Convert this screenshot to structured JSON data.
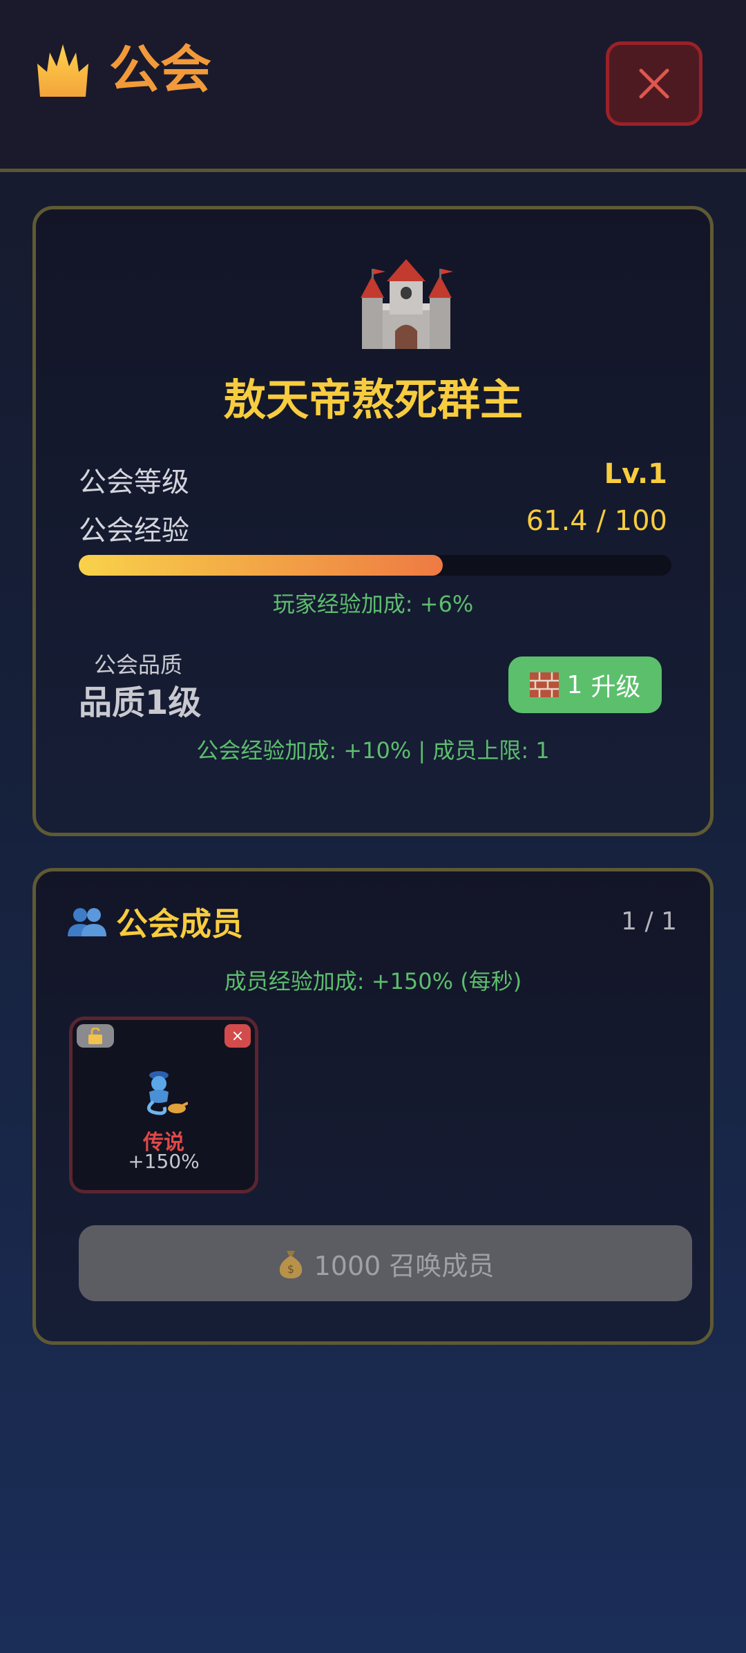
{
  "header": {
    "title": "公会",
    "crown_icon": "crown-icon",
    "close_icon": "close-icon"
  },
  "guild": {
    "castle_icon": "castle-icon",
    "name": "敖天帝熬死群主",
    "level_label": "公会等级",
    "level_value": "Lv.1",
    "exp_label": "公会经验",
    "exp_value": "61.4 / 100",
    "exp_progress": 0.614,
    "player_bonus": "玩家经验加成: +6%",
    "quality_label": "公会品质",
    "quality_value": "品质1级",
    "upgrade_cost": "1",
    "upgrade_label": "升级",
    "upgrade_icon": "brick-icon",
    "quality_bonus": "公会经验加成: +10% | 成员上限: 1"
  },
  "members": {
    "icon": "people-icon",
    "title": "公会成员",
    "count": "1 / 1",
    "bonus": "成员经验加成: +150% (每秒)",
    "list": [
      {
        "avatar": "genie-icon",
        "rarity": "传说",
        "bonus": "+150%",
        "lock_icon": "unlock-icon",
        "remove_label": "×"
      }
    ],
    "summon_icon": "money-bag-icon",
    "summon_label": "1000 召唤成员"
  },
  "colors": {
    "accent_orange": "#f29a3a",
    "gold": "#f7cc3e",
    "green": "#5dbd6e",
    "legendary_red": "#e04848"
  }
}
